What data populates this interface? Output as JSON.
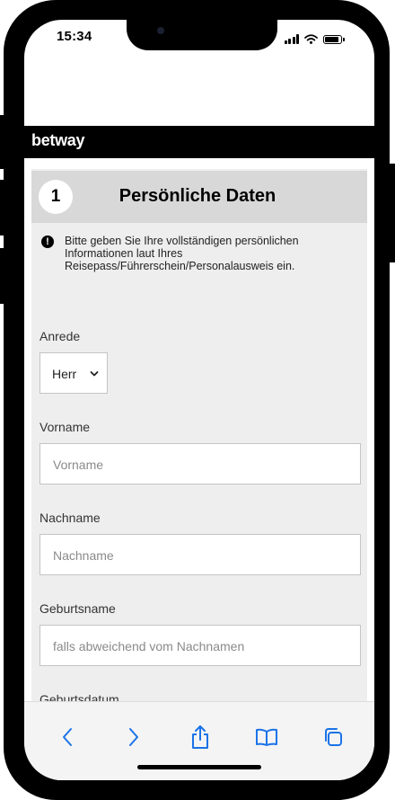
{
  "status": {
    "time": "15:34"
  },
  "brand": {
    "logo_text": "betway"
  },
  "section": {
    "step": "1",
    "title": "Persönliche Daten",
    "info_lines": [
      "Bitte geben Sie Ihre vollständigen persönlichen",
      "Informationen laut Ihres",
      "Reisepass/Führerschein/Personalausweis ein."
    ]
  },
  "form": {
    "salutation": {
      "label": "Anrede",
      "value": "Herr"
    },
    "first_name": {
      "label": "Vorname",
      "placeholder": "Vorname"
    },
    "last_name": {
      "label": "Nachname",
      "placeholder": "Nachname"
    },
    "birth_name": {
      "label": "Geburtsname",
      "placeholder": "falls abweichend vom Nachnamen"
    },
    "birth_date": {
      "label": "Geburtsdatum"
    }
  },
  "toolbar": {
    "icons": [
      "back-icon",
      "forward-icon",
      "share-icon",
      "bookmarks-icon",
      "tabs-icon"
    ],
    "accent_color": "#1a73e8"
  },
  "colors": {
    "brand_bar": "#000000",
    "form_background": "#eeeeee",
    "section_header": "#d8d8d8"
  }
}
